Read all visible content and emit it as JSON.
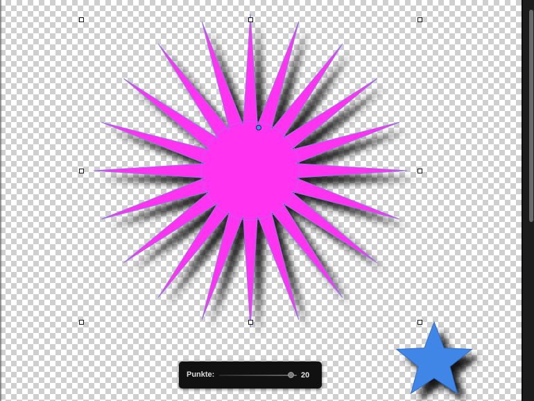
{
  "shape_hud": {
    "label": "Punkte:",
    "value": "20"
  },
  "sun_shape": {
    "points": 20,
    "color": "#ff33f0"
  },
  "star_shape": {
    "points": 5,
    "color": "#3f86e6"
  },
  "colors": {
    "shadow": "#000000",
    "selection_handle": "#ffffff"
  }
}
